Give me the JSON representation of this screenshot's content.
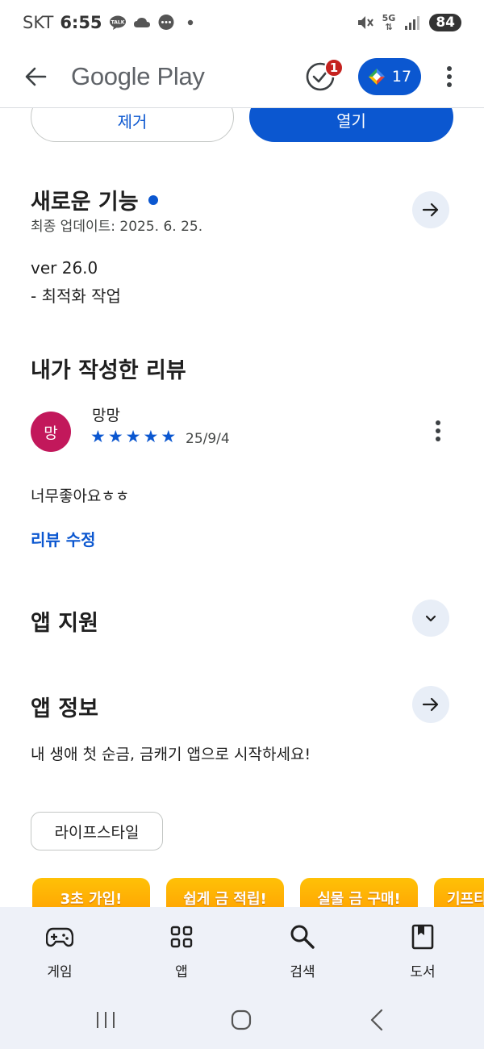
{
  "status_bar": {
    "carrier": "SKT",
    "time": "6:55",
    "network": "5G",
    "battery": "84"
  },
  "app_bar": {
    "title": "Google Play",
    "notification_count": "1",
    "points": "17"
  },
  "actions": {
    "remove_label": "제거",
    "open_label": "열기"
  },
  "whats_new": {
    "title": "새로운 기능",
    "last_updated": "최종 업데이트: 2025. 6. 25.",
    "version": "ver 26.0",
    "note": "- 최적화 작업"
  },
  "my_review": {
    "title": "내가 작성한 리뷰",
    "avatar_initial": "망",
    "reviewer": "망망",
    "rating": 5,
    "date": "25/9/4",
    "text": "너무좋아요ㅎㅎ",
    "edit_label": "리뷰 수정"
  },
  "app_support": {
    "title": "앱 지원"
  },
  "app_info": {
    "title": "앱 정보",
    "description": "내 생애 첫 순금, 금캐기 앱으로 시작하세요!",
    "category_chip": "라이프스타일"
  },
  "promo_cards": [
    {
      "label": "3초 가입!"
    },
    {
      "label": "쉽게 금 적립!"
    },
    {
      "label": "실물 금 구매!"
    },
    {
      "label": "기프티"
    }
  ],
  "bottom_nav": [
    {
      "label": "게임",
      "icon": "gamepad-icon"
    },
    {
      "label": "앱",
      "icon": "apps-grid-icon"
    },
    {
      "label": "검색",
      "icon": "search-icon"
    },
    {
      "label": "도서",
      "icon": "book-icon"
    }
  ],
  "colors": {
    "accent": "#0b57d0",
    "avatar": "#c2185b",
    "promo": "#ff9800",
    "badge": "#c5221f"
  }
}
